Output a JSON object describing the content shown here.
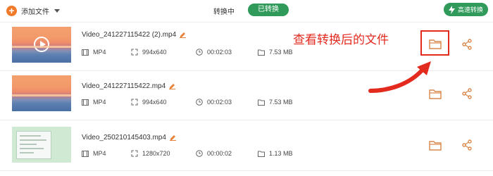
{
  "toolbar": {
    "add_files_label": "添加文件",
    "tab_converting": "转换中",
    "tab_converted": "已转换",
    "fast_convert_label": "高速转换"
  },
  "files": [
    {
      "name": "Video_241227115422 (2).mp4",
      "format": "MP4",
      "resolution": "994x640",
      "duration": "00:02:03",
      "size": "7.53 MB",
      "thumb": "sunset",
      "play_icon": true
    },
    {
      "name": "Video_241227115422.mp4",
      "format": "MP4",
      "resolution": "994x640",
      "duration": "00:02:03",
      "size": "7.53 MB",
      "thumb": "sunset",
      "play_icon": false
    },
    {
      "name": "Video_250210145403.mp4",
      "format": "MP4",
      "resolution": "1280x720",
      "duration": "00:00:02",
      "size": "1.13 MB",
      "thumb": "screen",
      "play_icon": false
    }
  ],
  "annotation": {
    "text": "查看转换后的文件",
    "color": "#e32a1f"
  },
  "colors": {
    "accent_orange": "#f07a2a",
    "accent_green": "#2f9a5a",
    "icon_orange": "#d9874a"
  },
  "icons": [
    "plus-icon",
    "caret-down-icon",
    "lightning-icon",
    "play-icon",
    "edit-icon",
    "film-icon",
    "resize-icon",
    "clock-icon",
    "folder-size-icon",
    "folder-icon",
    "share-icon",
    "arrow-icon"
  ]
}
